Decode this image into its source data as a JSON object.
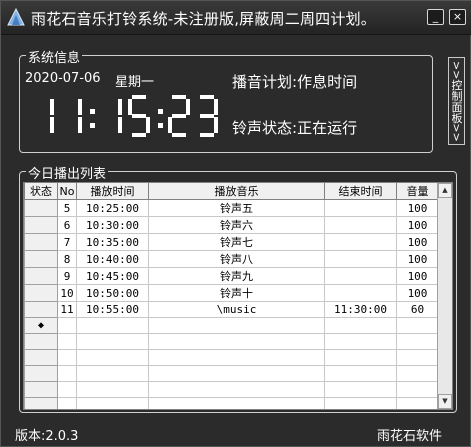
{
  "window": {
    "title": "雨花石音乐打铃系统-未注册版,屏蔽周二周四计划。",
    "minimize_label": "_",
    "close_label": "×"
  },
  "sysinfo": {
    "group_title": "系统信息",
    "date": "2020-07-06",
    "weekday": "星期一",
    "time": "11:15:23",
    "plan_label": "播音计划:",
    "plan_value": "作息时间",
    "bell_label": "铃声状态:",
    "bell_value": "正在运行"
  },
  "control_panel": {
    "label": ">>控制面板>>"
  },
  "playlist": {
    "group_title": "今日播出列表",
    "columns": [
      "状态",
      "No",
      "播放时间",
      "播放音乐",
      "结束时间",
      "音量"
    ],
    "rows": [
      {
        "state": "",
        "no": "5",
        "play_time": "10:25:00",
        "music": "铃声五",
        "end_time": "",
        "volume": "100"
      },
      {
        "state": "",
        "no": "6",
        "play_time": "10:30:00",
        "music": "铃声六",
        "end_time": "",
        "volume": "100"
      },
      {
        "state": "",
        "no": "7",
        "play_time": "10:35:00",
        "music": "铃声七",
        "end_time": "",
        "volume": "100"
      },
      {
        "state": "",
        "no": "8",
        "play_time": "10:40:00",
        "music": "铃声八",
        "end_time": "",
        "volume": "100"
      },
      {
        "state": "",
        "no": "9",
        "play_time": "10:45:00",
        "music": "铃声九",
        "end_time": "",
        "volume": "100"
      },
      {
        "state": "",
        "no": "10",
        "play_time": "10:50:00",
        "music": "铃声十",
        "end_time": "",
        "volume": "100"
      },
      {
        "state": "",
        "no": "11",
        "play_time": "10:55:00",
        "music": "\\music",
        "end_time": "11:30:00",
        "volume": "60"
      },
      {
        "state": "◆",
        "no": "",
        "play_time": "",
        "music": "",
        "end_time": "",
        "volume": ""
      },
      {
        "state": "",
        "no": "",
        "play_time": "",
        "music": "",
        "end_time": "",
        "volume": ""
      },
      {
        "state": "",
        "no": "",
        "play_time": "",
        "music": "",
        "end_time": "",
        "volume": ""
      },
      {
        "state": "",
        "no": "",
        "play_time": "",
        "music": "",
        "end_time": "",
        "volume": ""
      },
      {
        "state": "",
        "no": "",
        "play_time": "",
        "music": "",
        "end_time": "",
        "volume": ""
      },
      {
        "state": "",
        "no": "",
        "play_time": "",
        "music": "",
        "end_time": "",
        "volume": ""
      }
    ]
  },
  "footer": {
    "version": "版本:2.0.3",
    "vendor": "雨花石软件"
  },
  "colors": {
    "background": "#2b2b2b",
    "text": "#ffffff",
    "grid_bg": "#ffffff"
  },
  "icons": {
    "app": "music-app-icon",
    "scroll_up": "arrow-up-icon",
    "scroll_down": "arrow-down-icon"
  }
}
